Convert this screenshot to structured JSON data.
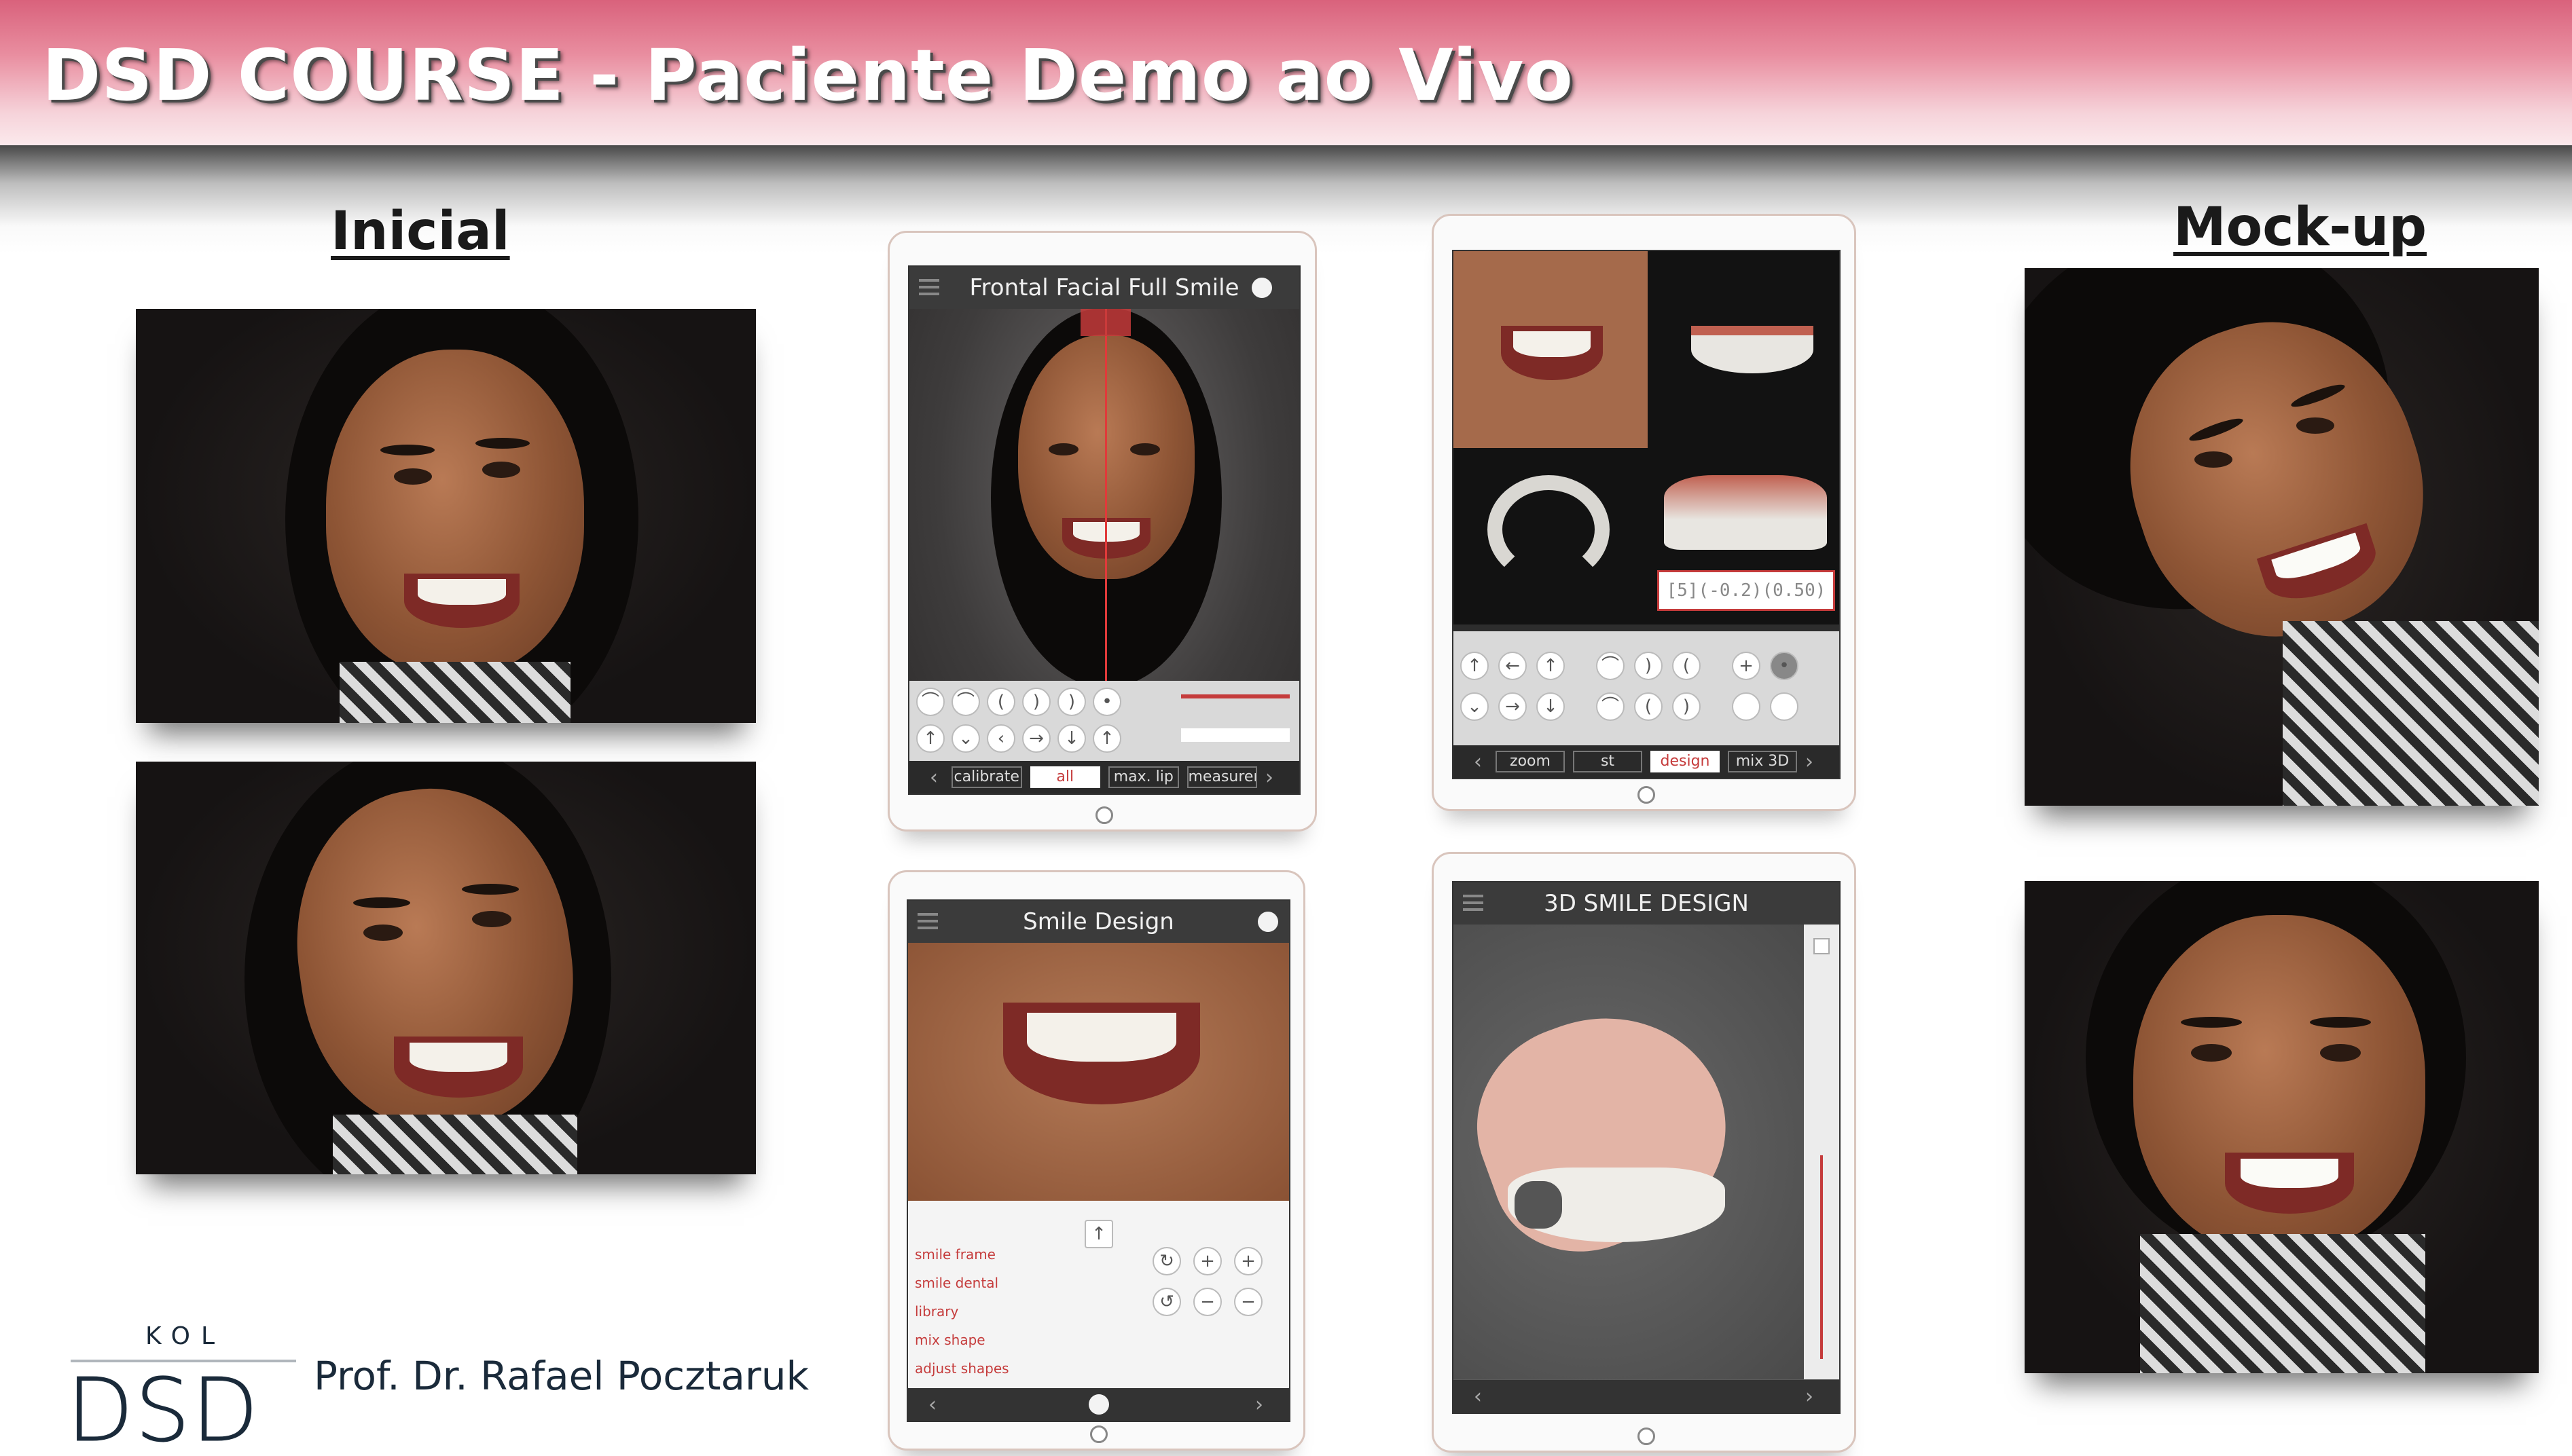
{
  "header": {
    "title": "DSD COURSE - Paciente Demo ao Vivo"
  },
  "labels": {
    "left": "Inicial",
    "right": "Mock-up"
  },
  "tablet1": {
    "title": "Frontal Facial Full Smile",
    "tabs": [
      "calibrate",
      "all",
      "max. lip",
      "measurement"
    ],
    "active_tab": "all"
  },
  "tablet2": {
    "tabs": [
      "zoom",
      "st",
      "design",
      "mix 3D"
    ],
    "active_tab": "design",
    "readout": "[5](-0.2)(0.50)"
  },
  "tablet3": {
    "title": "Smile Design",
    "side_items": [
      "smile frame",
      "smile dental library",
      "mix shape",
      "adjust shapes"
    ]
  },
  "tablet4": {
    "title": "3D SMILE DESIGN"
  },
  "footer": {
    "kol": "KOL",
    "logo": "DSD",
    "author": "Prof. Dr. Rafael Pocztaruk"
  },
  "colors": {
    "banner": "#e98ea0",
    "accent_red": "#c53b3b",
    "navy": "#1a2a3a"
  }
}
